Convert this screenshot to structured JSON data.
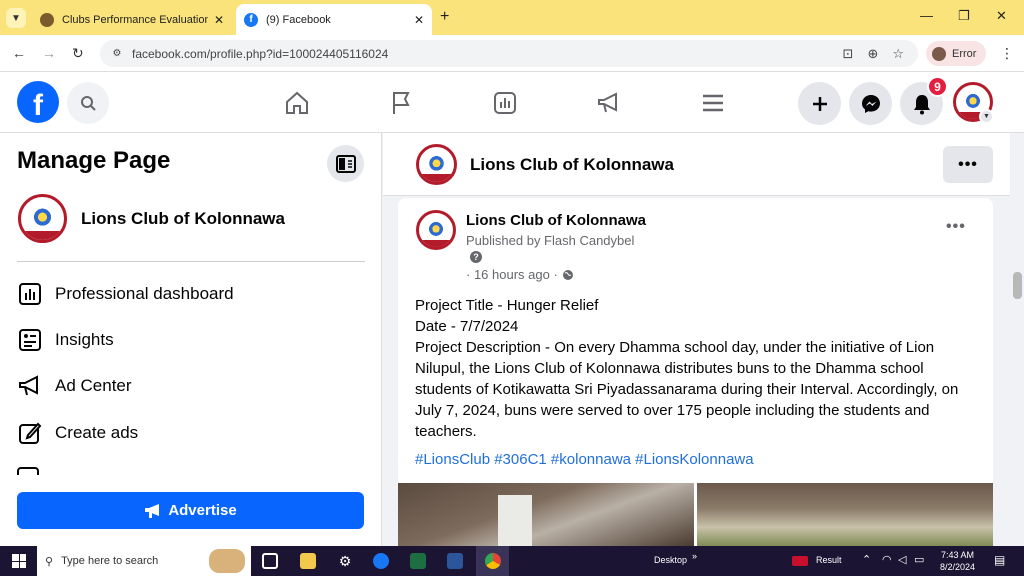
{
  "browser": {
    "tabs": [
      {
        "title": "Clubs Performance Evaluation S",
        "active": false
      },
      {
        "title": "(9) Facebook",
        "active": true
      }
    ],
    "url": "facebook.com/profile.php?id=100024405116024",
    "profile_label": "Error"
  },
  "fb": {
    "logo_glyph": "f",
    "notification_count": "9"
  },
  "sidebar": {
    "title": "Manage Page",
    "page_name": "Lions Club of Kolonnawa",
    "items": [
      {
        "label": "Professional dashboard",
        "icon": "dashboard-icon"
      },
      {
        "label": "Insights",
        "icon": "insights-icon"
      },
      {
        "label": "Ad Center",
        "icon": "megaphone-icon"
      },
      {
        "label": "Create ads",
        "icon": "pencil-icon"
      }
    ],
    "advertise_label": "Advertise"
  },
  "page_header": {
    "name": "Lions Club of Kolonnawa"
  },
  "post": {
    "author": "Lions Club of Kolonnawa",
    "published_by": "Published by Flash Candybel",
    "time": "· 16 hours ago ·",
    "lines": [
      "Project Title - Hunger Relief",
      "Date - 7/7/2024",
      "Project Description - On every Dhamma school day, under the initiative of Lion Nilupul, the Lions Club of Kolonnawa distributes buns to the Dhamma school students of Kotikawatta Sri Piyadassanarama during their Interval. Accordingly, on July 7, 2024, buns were served to over 175 people including the students and teachers."
    ],
    "hashtags": "#LionsClub #306C1 #kolonnawa #LionsKolonnawa"
  },
  "taskbar": {
    "search_placeholder": "Type here to search",
    "desktop_label": "Desktop",
    "result_label": "Result",
    "time": "7:43 AM",
    "date": "8/2/2024"
  },
  "colors": {
    "fb_blue": "#0866ff",
    "tabbar": "#f9e37a",
    "hashtag": "#216fdb",
    "badge_red": "#e41e3f"
  }
}
